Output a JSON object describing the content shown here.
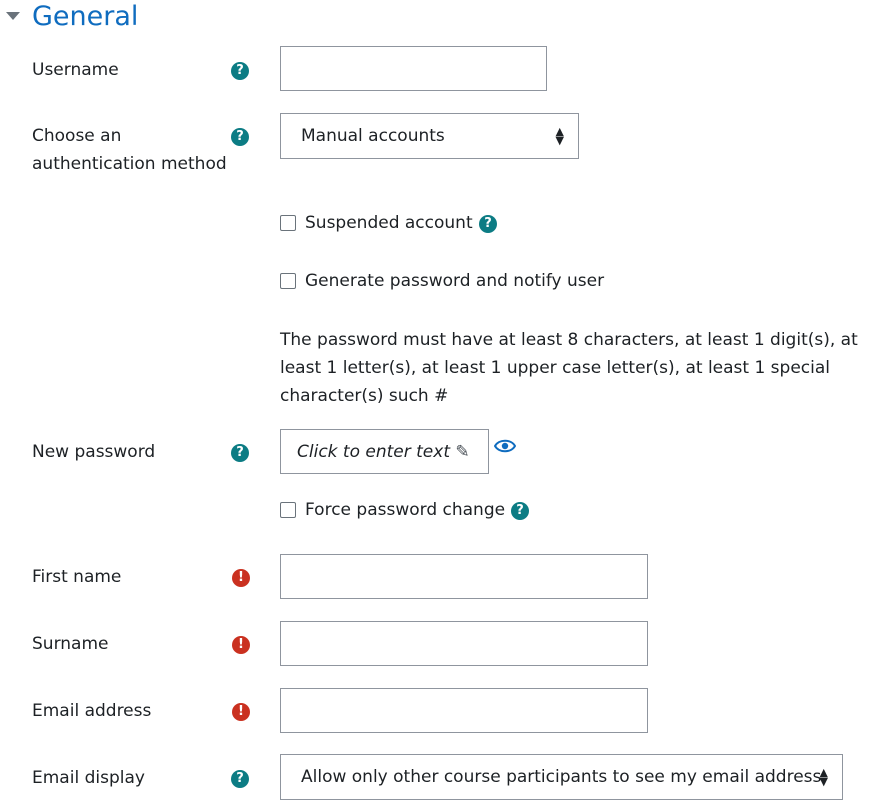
{
  "section": {
    "title": "General",
    "caret_icon": "caret-down-icon"
  },
  "fields": {
    "username": {
      "label": "Username",
      "value": ""
    },
    "auth": {
      "label_line1": "Choose an",
      "label_line2": "authentication method",
      "selected": "Manual accounts"
    },
    "suspended": {
      "label": "Suspended account",
      "checked": false
    },
    "generate_password": {
      "label": "Generate password and notify user",
      "checked": false
    },
    "password_note": "The password must have at least 8 characters, at least 1 digit(s), at least 1 letter(s), at least 1 upper case letter(s), at least 1 special character(s) such #",
    "new_password": {
      "label": "New password",
      "placeholder": "Click to enter text"
    },
    "force_change": {
      "label": "Force password change",
      "checked": false
    },
    "first_name": {
      "label": "First name",
      "value": ""
    },
    "surname": {
      "label": "Surname",
      "value": ""
    },
    "email": {
      "label": "Email address",
      "value": ""
    },
    "email_display": {
      "label": "Email display",
      "selected": "Allow only other course participants to see my email address"
    }
  },
  "icons": {
    "help": "question-circle-icon",
    "required": "exclamation-circle-icon",
    "edit": "pencil-icon",
    "reveal": "eye-icon",
    "select_arrow": "sort-arrows-icon"
  },
  "colors": {
    "accent": "#0f6cbf",
    "help": "#0c7c84",
    "required": "#ca3120"
  }
}
